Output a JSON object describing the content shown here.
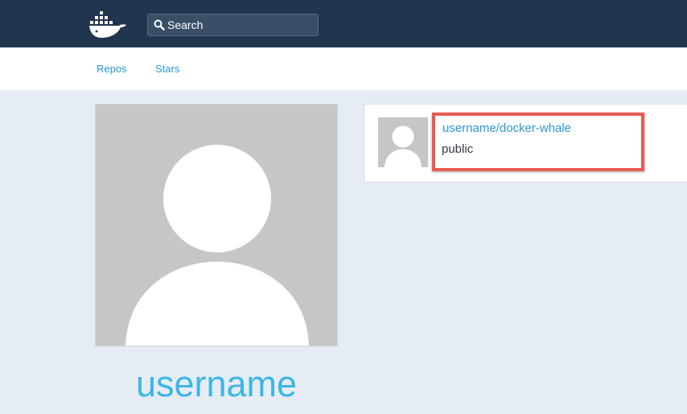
{
  "topbar": {
    "logo_icon": "docker-whale-icon",
    "search": {
      "icon": "search-icon",
      "placeholder": "Search"
    }
  },
  "subnav": {
    "links": [
      {
        "label": "Repos"
      },
      {
        "label": "Stars"
      }
    ]
  },
  "profile": {
    "avatar_icon": "default-user-avatar",
    "username": "username"
  },
  "repo_card": {
    "avatar_icon": "default-user-avatar",
    "name": "username/docker-whale",
    "visibility": "public",
    "highlight_color": "#e95b50"
  },
  "colors": {
    "topbar": "#22354f",
    "link": "#2b97d6",
    "username": "#3cb6e8",
    "background": "#e6ecf3"
  }
}
